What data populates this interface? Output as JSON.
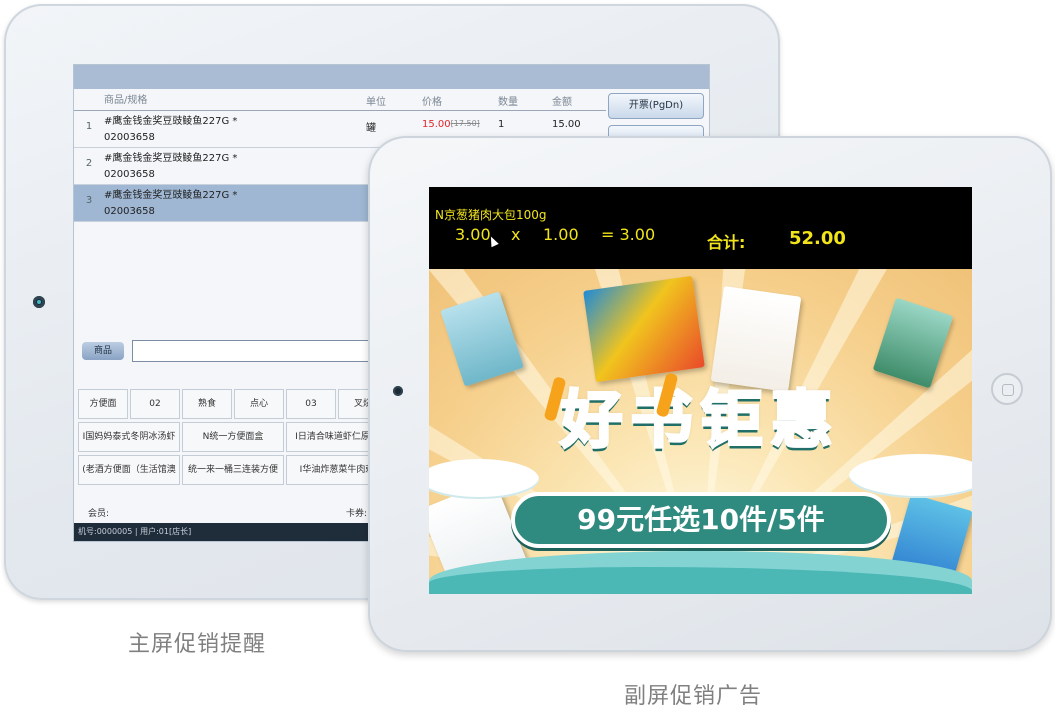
{
  "main_screen": {
    "table_headers": {
      "name": "商品/规格",
      "unit": "单位",
      "price": "价格",
      "qty": "数量",
      "amount": "金额"
    },
    "rows": [
      {
        "idx": "1",
        "name": "#鹰金钱金奖豆豉鲮鱼227G *",
        "code": "02003658",
        "unit": "罐",
        "price": "15.00",
        "old_price": "17.50",
        "qty": "1",
        "amount": "15.00"
      },
      {
        "idx": "2",
        "name": "#鹰金钱金奖豆豉鲮鱼227G *",
        "code": "02003658",
        "unit": "",
        "price": "",
        "old_price": "",
        "qty": "",
        "amount": ""
      },
      {
        "idx": "3",
        "name": "#鹰金钱金奖豆豉鲮鱼227G *",
        "code": "02003658",
        "unit": "",
        "price": "",
        "old_price": "",
        "qty": "",
        "amount": ""
      }
    ],
    "side_buttons": [
      "开票(PgDn)"
    ],
    "search_label": "商品",
    "grid": [
      [
        "方便面",
        "02",
        "熟食",
        "点心",
        "03",
        "叉烧"
      ],
      [
        "I国妈妈泰式冬阴冰汤虾",
        "N统一方便面盒",
        "I日清合味道虾仁原味"
      ],
      [
        "(老酒方便面（生活馆澳",
        "统一来一桶三连装方便",
        "I华油炸葱菜牛肉剌"
      ]
    ],
    "member_label": "会员:",
    "card_label": "卡券:",
    "status_bar": "机号:0000005 | 用户:01[店长]"
  },
  "sub_screen": {
    "item_name": "N京葱猪肉大包100g",
    "unit_price": "3.00",
    "times": "x",
    "quantity": "1.00",
    "equals": "= 3.00",
    "total_label": "合计:",
    "total_value": "52.00",
    "ad_headline": "好书钜惠",
    "ad_offer": "99元任选10件/5件"
  },
  "captions": {
    "main": "主屏促销提醒",
    "sub": "副屏促销广告"
  },
  "colors": {
    "ticker_text": "#f2e41a",
    "price_red": "#e0262b",
    "headline_teal": "#2f8e85",
    "selected_row": "#9fb7d3"
  }
}
